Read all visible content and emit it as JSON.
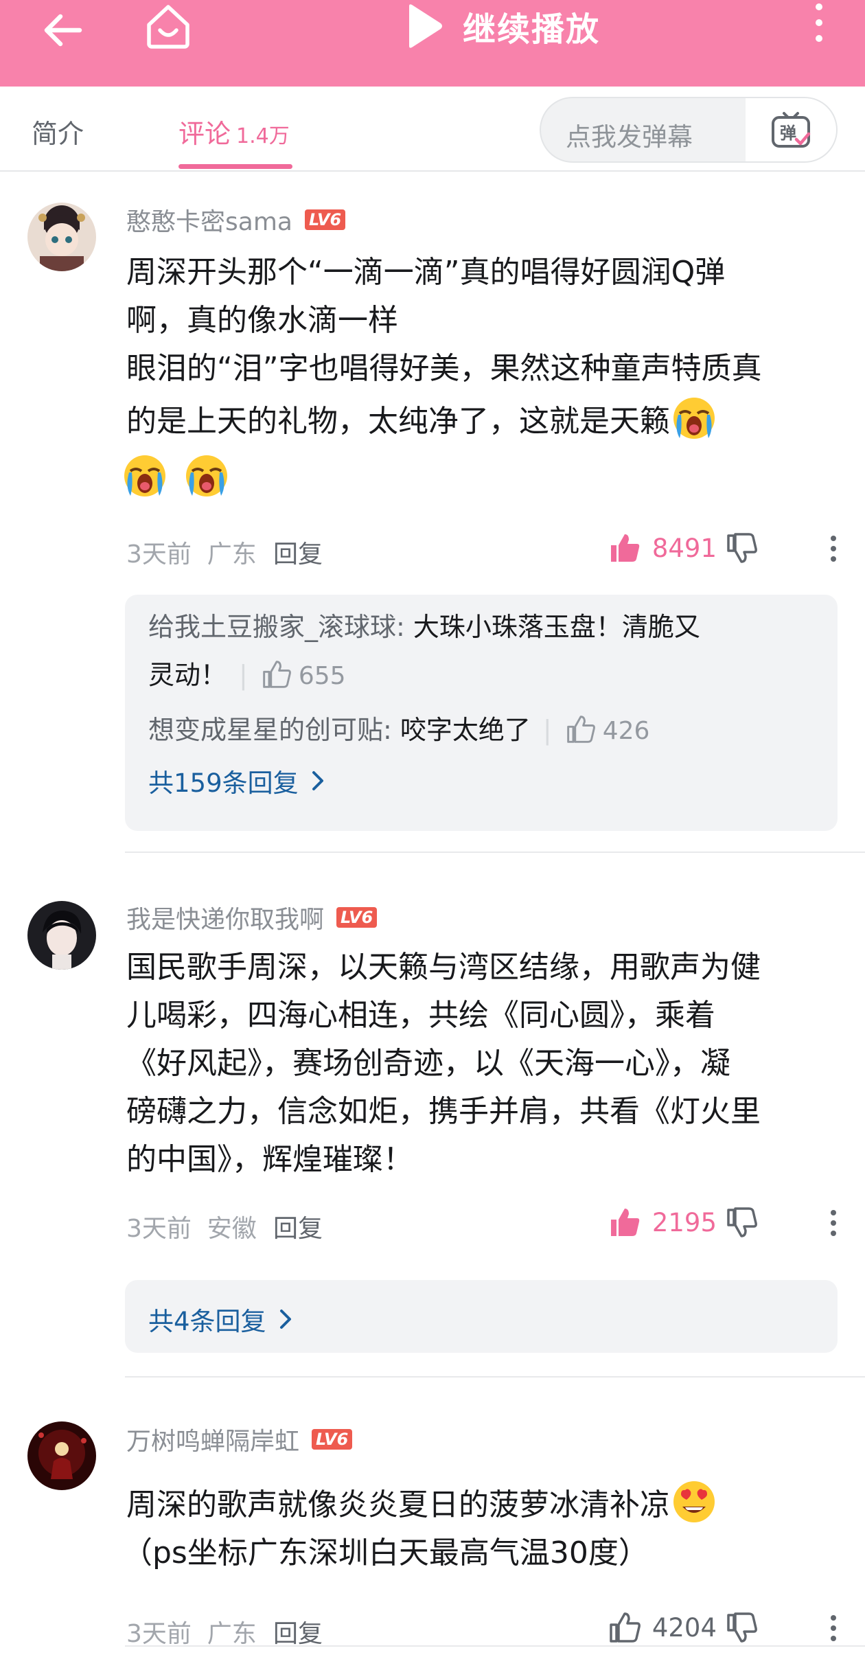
{
  "topbar": {
    "play_label": "继续播放",
    "icons": [
      "back-arrow-icon",
      "home-tv-icon",
      "play-icon",
      "more-vertical-icon"
    ],
    "background": "#f882ab"
  },
  "tabs": {
    "intro": "简介",
    "comments": "评论",
    "comments_count": "1.4万",
    "danmaku_placeholder": "点我发弹幕",
    "danmaku_icon_text": "弹"
  },
  "comments": [
    {
      "username": "憨憨卡密sama",
      "level": "LV6",
      "text_lines": [
        "周深开头那个“一滴一滴”真的唱得好圆润Q弹",
        "啊，真的像水滴一样",
        "眼泪的“泪”字也唱得好美，果然这种童声特质真",
        "的是上天的礼物，太纯净了，这就是天籁"
      ],
      "emoji": "crying-face-emoji",
      "time": "3天前",
      "location": "广东",
      "reply_label": "回复",
      "likes": "8491",
      "liked": true,
      "replies": [
        {
          "user": "给我土豆搬家_滚球球:",
          "text": "大珠小珠落玉盘！清脆又",
          "text2": "灵动！",
          "likes": "655"
        },
        {
          "user": "想变成星星的创可贴:",
          "text": "咬字太绝了",
          "likes": "426"
        }
      ],
      "more_replies": "共159条回复"
    },
    {
      "username": "我是快递你取我啊",
      "level": "LV6",
      "text_lines": [
        "国民歌手周深，以天籁与湾区结缘，用歌声为健",
        "儿喝彩，四海心相连，共绘《同心圆》，乘着",
        "《好风起》，赛场创奇迹，以《天海一心》，凝",
        "磅礴之力，信念如炬，携手并肩，共看《灯火里",
        "的中国》，辉煌璀璨！"
      ],
      "time": "3天前",
      "location": "安徽",
      "reply_label": "回复",
      "likes": "2195",
      "liked": true,
      "more_replies": "共4条回复"
    },
    {
      "username": "万树鸣蝉隔岸虹",
      "level": "LV6",
      "text_lines": [
        "周深的歌声就像炎炎夏日的菠萝冰清补凉",
        "（ps坐标广东深圳白天最高气温30度）"
      ],
      "emoji": "heart-eyes-emoji",
      "time": "3天前",
      "location": "广东",
      "reply_label": "回复",
      "likes": "4204",
      "liked": false
    }
  ],
  "colors": {
    "accent_pink": "#f06a9a",
    "link_blue": "#1a5f9e",
    "level_badge": "#ee5b4f"
  }
}
